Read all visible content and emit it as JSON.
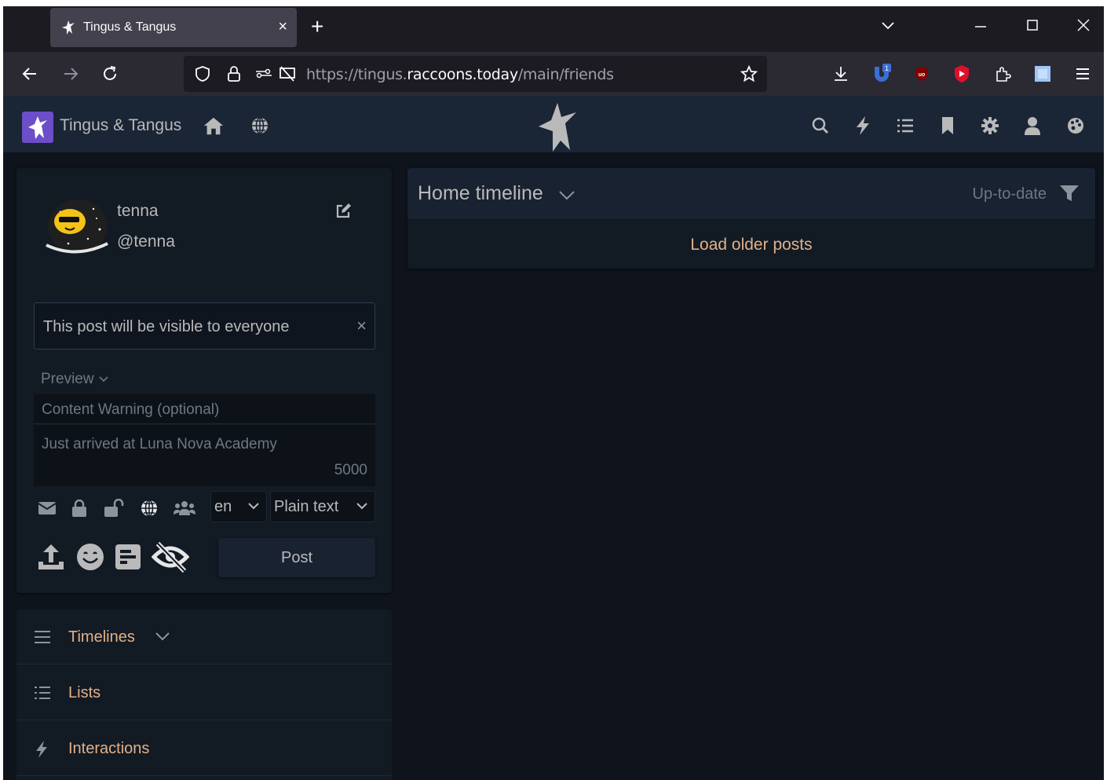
{
  "browser": {
    "tab_title": "Tingus & Tangus",
    "tab_close": "×",
    "new_tab": "+",
    "url_prefix": "https://tingus.",
    "url_domain": "raccoons.today",
    "url_path": "/main/friends",
    "extension_badge": "1"
  },
  "app": {
    "site_name": "Tingus & Tangus",
    "accent_color": "#e2b188",
    "header_bg": "#1a2535"
  },
  "user": {
    "name": "tenna",
    "handle": "@tenna"
  },
  "composer": {
    "visibility_notice": "This post will be visible to everyone",
    "dismiss": "×",
    "preview_label": "Preview",
    "cw_placeholder": "Content Warning (optional)",
    "status_placeholder": "Just arrived at Luna Nova Academy",
    "char_count": "5000",
    "language": "en",
    "format": "Plain text",
    "post_label": "Post"
  },
  "nav": {
    "items": [
      {
        "label": "Timelines",
        "icon": "menu-icon"
      },
      {
        "label": "Lists",
        "icon": "list-icon"
      },
      {
        "label": "Interactions",
        "icon": "bolt-icon"
      }
    ]
  },
  "timeline": {
    "title": "Home timeline",
    "status": "Up-to-date",
    "load_older": "Load older posts"
  }
}
